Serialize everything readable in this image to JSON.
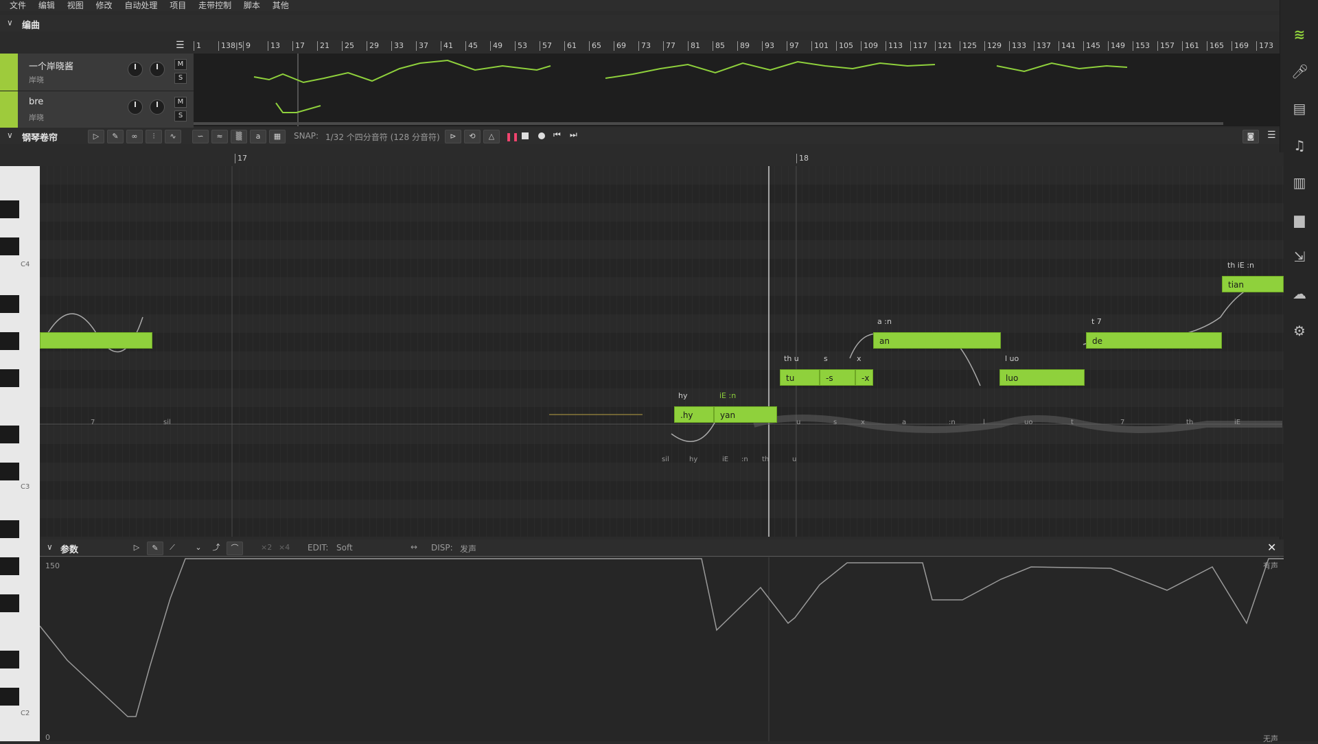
{
  "menu": [
    "文件",
    "编辑",
    "视图",
    "修改",
    "自动处理",
    "项目",
    "走带控制",
    "脚本",
    "其他"
  ],
  "arrange": {
    "title": "编曲",
    "ruler_ticks": [
      "1",
      "138|5",
      "9",
      "13",
      "17",
      "21",
      "25",
      "29",
      "33",
      "37",
      "41",
      "45",
      "49",
      "53",
      "57",
      "61",
      "65",
      "69",
      "73",
      "77",
      "81",
      "85",
      "89",
      "93",
      "97",
      "101",
      "105",
      "109",
      "113",
      "117",
      "121",
      "125",
      "129",
      "133",
      "137",
      "141",
      "145",
      "149",
      "153",
      "157",
      "161",
      "165",
      "169",
      "173"
    ],
    "tracks": [
      {
        "name": "一个岸晓酱",
        "singer": "岸晓",
        "m": "M",
        "s": "S"
      },
      {
        "name": "bre",
        "singer": "岸晓",
        "m": "M",
        "s": "S"
      }
    ]
  },
  "piano_roll": {
    "title": "钢琴卷帘",
    "snap_label": "SNAP:",
    "snap_value": "1/32 个四分音符 (128 分音符)",
    "bar_17": "17",
    "bar_18": "18",
    "key_labels": [
      "C4",
      "C3",
      "C2"
    ],
    "notes": [
      {
        "lyric": "",
        "phonemes": ""
      },
      {
        "lyric": ".hy",
        "phonemes": "hy"
      },
      {
        "lyric": "yan",
        "phonemes": "iE :n"
      },
      {
        "lyric": "tu",
        "phonemes": "th u"
      },
      {
        "lyric": "-s",
        "phonemes": "s"
      },
      {
        "lyric": "-x",
        "phonemes": "x"
      },
      {
        "lyric": "an",
        "phonemes": "a :n"
      },
      {
        "lyric": "luo",
        "phonemes": "l uo"
      },
      {
        "lyric": "de",
        "phonemes": "t 7"
      },
      {
        "lyric": "tian",
        "phonemes": "th iE :n"
      }
    ],
    "wave_labels": [
      "7",
      "sil",
      "u",
      "s",
      "x",
      "a",
      ":n",
      "l",
      "uo",
      "t",
      "7",
      "th",
      "iE"
    ],
    "wave2_labels": [
      "sil",
      "hy",
      "iE",
      ":n",
      "th",
      "u"
    ]
  },
  "params": {
    "title": "参数",
    "edit_label": "EDIT:",
    "edit_value": "Soft",
    "disp_label": "DISP:",
    "disp_value": "发声",
    "x2": "×2",
    "x4": "×4",
    "max_value": "150",
    "corner_top": "有声",
    "corner_bottom": "无声",
    "min_value": "0"
  },
  "colors": {
    "accent": "#8fd13c",
    "bg": "#2b2b2b"
  }
}
